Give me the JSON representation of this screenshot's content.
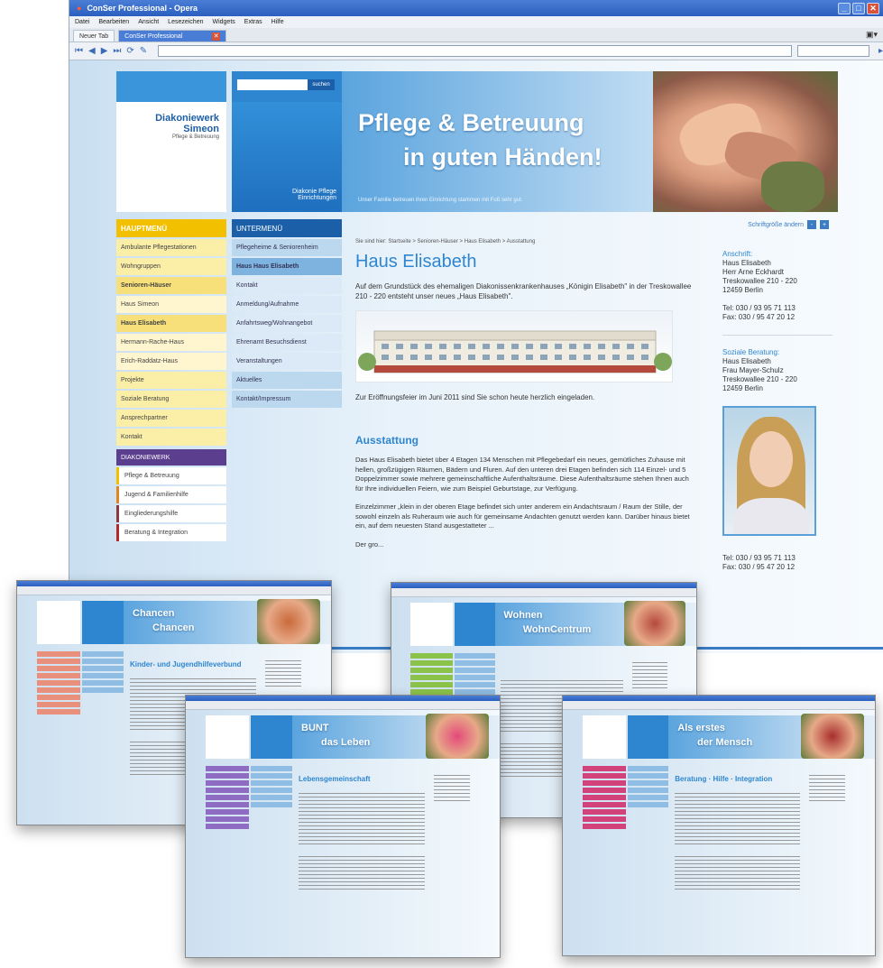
{
  "window": {
    "title": "ConSer Professional - Opera",
    "menu": [
      "Datei",
      "Bearbeiten",
      "Ansicht",
      "Lesezeichen",
      "Widgets",
      "Extras",
      "Hilfe"
    ],
    "tabs": [
      {
        "label": "Neuer Tab"
      },
      {
        "label": "ConSer Professional"
      }
    ]
  },
  "site": {
    "search_button": "suchen",
    "logo_line1": "Diakoniewerk",
    "logo_line2": "Simeon",
    "logo_line3": "Pflege & Betreuung",
    "blue_caption_line1": "Diakonie Pflege",
    "blue_caption_line2": "Einrichtungen",
    "banner_line1": "Pflege & Betreuung",
    "banner_line2": "in guten Händen!",
    "banner_caption": "Unser Familie betreuen ihren Einrichtung stammen mit Fuß sehr gut.",
    "font_size_label": "Schriftgröße ändern",
    "hauptmenu_head": "HAUPTMENÜ",
    "hauptmenu": [
      {
        "label": "Ambulante Pflegestationen",
        "state": ""
      },
      {
        "label": "Wohngruppen",
        "state": ""
      },
      {
        "label": "Senioren-Häuser",
        "state": "sel"
      },
      {
        "label": "Haus Simeon",
        "state": "sub"
      },
      {
        "label": "Haus Elisabeth",
        "state": "sel"
      },
      {
        "label": "Hermann-Rache-Haus",
        "state": "sub"
      },
      {
        "label": "Erich-Raddatz-Haus",
        "state": "sub"
      },
      {
        "label": "Projekte",
        "state": ""
      },
      {
        "label": "Soziale Beratung",
        "state": ""
      },
      {
        "label": "Ansprechpartner",
        "state": ""
      },
      {
        "label": "Kontakt",
        "state": ""
      }
    ],
    "violet_head": "DIAKONIEWERK",
    "violet_items": [
      {
        "label": "Pflege & Betreuung",
        "c": ""
      },
      {
        "label": "Jugend & Familienhilfe",
        "c": "c2"
      },
      {
        "label": "Eingliederungshilfe",
        "c": "c3"
      },
      {
        "label": "Beratung & Integration",
        "c": "c4"
      }
    ],
    "untermenu_head": "UNTERMENÜ",
    "untermenu": [
      {
        "label": "Pflegeheime & Seniorenheim",
        "state": ""
      },
      {
        "label": "Haus Haus Elisabeth",
        "state": "sel"
      },
      {
        "label": "Kontakt",
        "state": "light"
      },
      {
        "label": "Anmeldung/Aufnahme",
        "state": "light"
      },
      {
        "label": "Anfahrtsweg/Wohnangebot",
        "state": "light"
      },
      {
        "label": "Ehrenamt Besuchsdienst",
        "state": "light"
      },
      {
        "label": "Veranstaltungen",
        "state": "light"
      },
      {
        "label": "Aktuelles",
        "state": ""
      },
      {
        "label": "Kontakt/Impressum",
        "state": ""
      }
    ],
    "breadcrumb": "Sie sind hier: Startseite > Senioren-Häuser > Haus Elisabeth > Ausstattung",
    "page_title": "Haus Elisabeth",
    "intro": "Auf dem Grundstück des ehemaligen Diakonissenkrankenhauses „Königin Elisabeth\" in der Treskowallee 210 - 220 entsteht unser neues „Haus Elisabeth\".",
    "caption": "Zur Eröffnungsfeier im Juni 2011 sind Sie schon heute herzlich eingeladen.",
    "subtitle": "Ausstattung",
    "para1": "Das Haus Elisabeth bietet über 4 Etagen 134 Menschen mit Pflegebedarf ein neues, gemütliches Zuhause mit hellen, großzügigen Räumen, Bädern und Fluren. Auf den unteren drei Etagen befinden sich 114 Einzel- und 5 Doppelzimmer sowie mehrere gemeinschaftliche Aufenthaltsräume. Diese Aufenthaltsräume stehen Ihnen auch für Ihre individuellen Feiern, wie zum Beispiel Geburtstage, zur Verfügung.",
    "para2": "Einzelzimmer „klein in der oberen Etage befindet sich unter anderem ein Andachtsraum / Raum der Stille, der sowohl einzeln als Ruheraum wie auch für gemeinsame Andachten genutzt werden kann. Darüber hinaus bietet ein, auf dem neuesten Stand ausgestatteter ...",
    "para3": "Der gro...",
    "info_address_title": "Anschrift:",
    "info_address": [
      "Haus Elisabeth",
      "Herr Arne Eckhardt",
      "Treskowallee 210 - 220",
      "12459 Berlin"
    ],
    "info_phone1": "Tel: 030 / 93 95 71 113",
    "info_fax1": "Fax: 030 / 95 47 20 12",
    "info_social_title": "Soziale Beratung:",
    "info_social": [
      "Haus Elisabeth",
      "Frau Mayer-Schulz",
      "Treskowallee 210 - 220",
      "12459 Berlin"
    ],
    "info_phone2": "Tel: 030 / 93 95 71 113",
    "info_fax2": "Fax: 030 / 95 47 20 12"
  },
  "minis": [
    {
      "heading1": "Chancen",
      "heading2": "Chancen",
      "title": "Kinder- und Jugendhilfeverbund",
      "menu_color": "#e9907d",
      "img_color": "#c96a3a"
    },
    {
      "heading1": "Wohnen",
      "heading2": "WohnCentrum",
      "title": "",
      "menu_color": "#8bc34a",
      "img_color": "#b54a3d"
    },
    {
      "heading1": "BUNT",
      "heading2": "das Leben",
      "title": "Lebensgemeinschaft",
      "menu_color": "#8e6cc4",
      "img_color": "#e44a7a"
    },
    {
      "heading1": "Als erstes",
      "heading2": "der Mensch",
      "title": "Beratung · Hilfe · Integration",
      "menu_color": "#d1437a",
      "img_color": "#a82e2e"
    }
  ]
}
